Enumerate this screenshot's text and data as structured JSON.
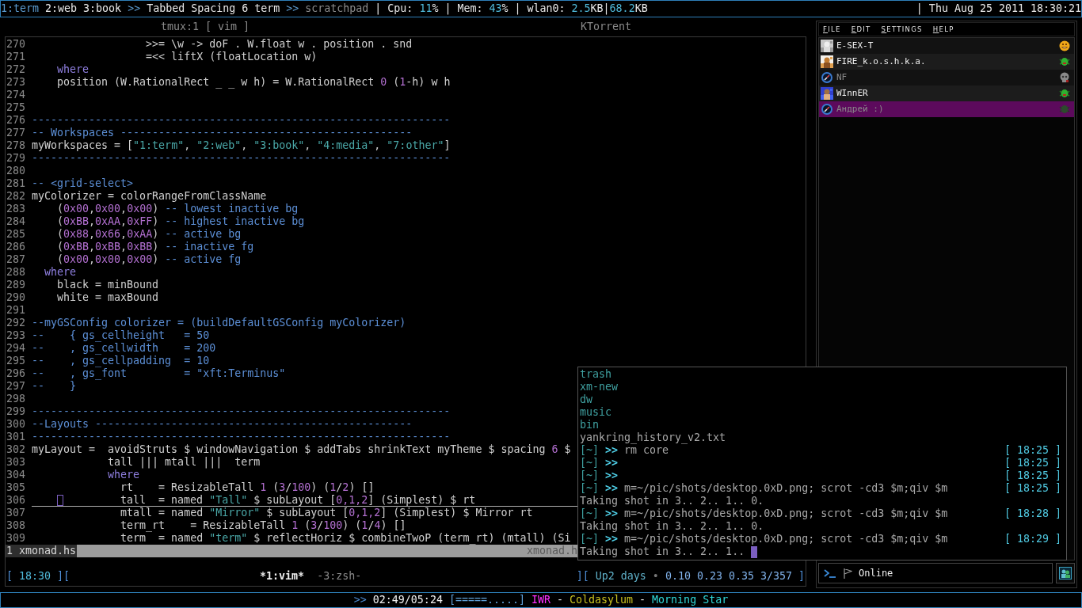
{
  "top_bar": {
    "workspaces": [
      {
        "label": "1:term",
        "selected": true
      },
      {
        "label": "2:web",
        "selected": false
      },
      {
        "label": "3:book",
        "selected": false
      }
    ],
    "layout_separator": ">>",
    "layout": "Tabbed Spacing 6 term",
    "hidden_separator": ">>",
    "hidden_workspace": "scratchpad",
    "stats": [
      {
        "text": "| Cpu: ",
        "kind": "label"
      },
      {
        "text": "11",
        "kind": "value"
      },
      {
        "text": "% | Mem: ",
        "kind": "label"
      },
      {
        "text": "43",
        "kind": "value"
      },
      {
        "text": "% | wlan0: ",
        "kind": "label"
      },
      {
        "text": "2.5",
        "kind": "value"
      },
      {
        "text": "KB|",
        "kind": "label"
      },
      {
        "text": "68.2",
        "kind": "value"
      },
      {
        "text": "KB",
        "kind": "label"
      }
    ],
    "clock": "| Thu Aug 25 2011 18:30:21"
  },
  "window_tabs": [
    {
      "label": "tmux:1 [ vim ]"
    },
    {
      "label": "KTorrent"
    }
  ],
  "editor": {
    "lines": [
      {
        "number": "270",
        "cursor_line": false,
        "segments": [
          {
            "text": "                  >>= \\w -> doF . W.float w . position . snd",
            "kind": "code"
          }
        ]
      },
      {
        "number": "271",
        "cursor_line": false,
        "segments": [
          {
            "text": "                  =<< liftX (floatLocation w)",
            "kind": "code"
          }
        ]
      },
      {
        "number": "272",
        "cursor_line": false,
        "segments": [
          {
            "text": "    where",
            "kind": "keyword"
          }
        ]
      },
      {
        "number": "273",
        "cursor_line": false,
        "segments": [
          {
            "text": "    position (W.RationalRect _ _ w h) = W.RationalRect ",
            "kind": "code"
          },
          {
            "text": "0",
            "kind": "number"
          },
          {
            "text": " (",
            "kind": "code"
          },
          {
            "text": "1",
            "kind": "number"
          },
          {
            "text": "-h) w h",
            "kind": "code"
          }
        ]
      },
      {
        "number": "274",
        "cursor_line": false
      },
      {
        "number": "275",
        "cursor_line": false
      },
      {
        "number": "276",
        "cursor_line": false,
        "segments": [
          {
            "text": "------------------------------------------------------------------",
            "kind": "comment"
          }
        ]
      },
      {
        "number": "277",
        "cursor_line": false,
        "segments": [
          {
            "text": "-- Workspaces ----------------------------------------------",
            "kind": "comment"
          }
        ]
      },
      {
        "number": "278",
        "cursor_line": false,
        "segments": [
          {
            "text": "myWorkspaces = [",
            "kind": "code"
          },
          {
            "text": "\"1:term\"",
            "kind": "string"
          },
          {
            "text": ", ",
            "kind": "code"
          },
          {
            "text": "\"2:web\"",
            "kind": "string"
          },
          {
            "text": ", ",
            "kind": "code"
          },
          {
            "text": "\"3:book\"",
            "kind": "string"
          },
          {
            "text": ", ",
            "kind": "code"
          },
          {
            "text": "\"4:media\"",
            "kind": "string"
          },
          {
            "text": ", ",
            "kind": "code"
          },
          {
            "text": "\"7:other\"",
            "kind": "string"
          },
          {
            "text": "]",
            "kind": "code"
          }
        ]
      },
      {
        "number": "279",
        "cursor_line": false,
        "segments": [
          {
            "text": "------------------------------------------------------------------",
            "kind": "comment"
          }
        ]
      },
      {
        "number": "280",
        "cursor_line": false
      },
      {
        "number": "281",
        "cursor_line": false,
        "segments": [
          {
            "text": "-- <grid-select>",
            "kind": "comment"
          }
        ]
      },
      {
        "number": "282",
        "cursor_line": false,
        "segments": [
          {
            "text": "myColorizer = colorRangeFromClassName",
            "kind": "code"
          }
        ]
      },
      {
        "number": "283",
        "cursor_line": false,
        "segments": [
          {
            "text": "    (",
            "kind": "code"
          },
          {
            "text": "0x00",
            "kind": "number"
          },
          {
            "text": ",",
            "kind": "code"
          },
          {
            "text": "0x00",
            "kind": "number"
          },
          {
            "text": ",",
            "kind": "code"
          },
          {
            "text": "0x00",
            "kind": "number"
          },
          {
            "text": ") ",
            "kind": "code"
          },
          {
            "text": "-- lowest inactive bg",
            "kind": "comment"
          }
        ]
      },
      {
        "number": "284",
        "cursor_line": false,
        "segments": [
          {
            "text": "    (",
            "kind": "code"
          },
          {
            "text": "0xBB",
            "kind": "number"
          },
          {
            "text": ",",
            "kind": "code"
          },
          {
            "text": "0xAA",
            "kind": "number"
          },
          {
            "text": ",",
            "kind": "code"
          },
          {
            "text": "0xFF",
            "kind": "number"
          },
          {
            "text": ") ",
            "kind": "code"
          },
          {
            "text": "-- highest inactive bg",
            "kind": "comment"
          }
        ]
      },
      {
        "number": "285",
        "cursor_line": false,
        "segments": [
          {
            "text": "    (",
            "kind": "code"
          },
          {
            "text": "0x88",
            "kind": "number"
          },
          {
            "text": ",",
            "kind": "code"
          },
          {
            "text": "0x66",
            "kind": "number"
          },
          {
            "text": ",",
            "kind": "code"
          },
          {
            "text": "0xAA",
            "kind": "number"
          },
          {
            "text": ") ",
            "kind": "code"
          },
          {
            "text": "-- active bg",
            "kind": "comment"
          }
        ]
      },
      {
        "number": "286",
        "cursor_line": false,
        "segments": [
          {
            "text": "    (",
            "kind": "code"
          },
          {
            "text": "0xBB",
            "kind": "number"
          },
          {
            "text": ",",
            "kind": "code"
          },
          {
            "text": "0xBB",
            "kind": "number"
          },
          {
            "text": ",",
            "kind": "code"
          },
          {
            "text": "0xBB",
            "kind": "number"
          },
          {
            "text": ") ",
            "kind": "code"
          },
          {
            "text": "-- inactive fg",
            "kind": "comment"
          }
        ]
      },
      {
        "number": "287",
        "cursor_line": false,
        "segments": [
          {
            "text": "    (",
            "kind": "code"
          },
          {
            "text": "0x00",
            "kind": "number"
          },
          {
            "text": ",",
            "kind": "code"
          },
          {
            "text": "0x00",
            "kind": "number"
          },
          {
            "text": ",",
            "kind": "code"
          },
          {
            "text": "0x00",
            "kind": "number"
          },
          {
            "text": ") ",
            "kind": "code"
          },
          {
            "text": "-- active fg",
            "kind": "comment"
          }
        ]
      },
      {
        "number": "288",
        "cursor_line": false,
        "segments": [
          {
            "text": "  where",
            "kind": "keyword"
          }
        ]
      },
      {
        "number": "289",
        "cursor_line": false,
        "segments": [
          {
            "text": "    black = minBound",
            "kind": "code"
          }
        ]
      },
      {
        "number": "290",
        "cursor_line": false,
        "segments": [
          {
            "text": "    white = maxBound",
            "kind": "code"
          }
        ]
      },
      {
        "number": "291",
        "cursor_line": false
      },
      {
        "number": "292",
        "cursor_line": false,
        "segments": [
          {
            "text": "--myGSConfig colorizer = (buildDefaultGSConfig myColorizer)",
            "kind": "comment"
          }
        ]
      },
      {
        "number": "293",
        "cursor_line": false,
        "segments": [
          {
            "text": "--    { gs_cellheight   = 50",
            "kind": "comment"
          }
        ]
      },
      {
        "number": "294",
        "cursor_line": false,
        "segments": [
          {
            "text": "--    , gs_cellwidth    = 200",
            "kind": "comment"
          }
        ]
      },
      {
        "number": "295",
        "cursor_line": false,
        "segments": [
          {
            "text": "--    , gs_cellpadding  = 10",
            "kind": "comment"
          }
        ]
      },
      {
        "number": "296",
        "cursor_line": false,
        "segments": [
          {
            "text": "--    , gs_font         = \"xft:Terminus\"",
            "kind": "comment"
          }
        ]
      },
      {
        "number": "297",
        "cursor_line": false,
        "segments": [
          {
            "text": "--    }",
            "kind": "comment"
          }
        ]
      },
      {
        "number": "298",
        "cursor_line": false
      },
      {
        "number": "299",
        "cursor_line": false,
        "segments": [
          {
            "text": "------------------------------------------------------------------",
            "kind": "comment"
          }
        ]
      },
      {
        "number": "300",
        "cursor_line": false,
        "segments": [
          {
            "text": "--Layouts --------------------------------------------------",
            "kind": "comment"
          }
        ]
      },
      {
        "number": "301",
        "cursor_line": false,
        "segments": [
          {
            "text": "------------------------------------------------------------------",
            "kind": "comment"
          }
        ]
      },
      {
        "number": "302",
        "cursor_line": false,
        "segments": [
          {
            "text": "myLayout =  avoidStruts $ windowNavigation $ addTabs shrinkText myTheme $ spacing ",
            "kind": "code"
          },
          {
            "text": "6",
            "kind": "number"
          },
          {
            "text": " $",
            "kind": "code"
          }
        ]
      },
      {
        "number": "303",
        "cursor_line": false,
        "segments": [
          {
            "text": "            tall ||| mtall |||  term",
            "kind": "code"
          }
        ]
      },
      {
        "number": "304",
        "cursor_line": false,
        "segments": [
          {
            "text": "            where",
            "kind": "keyword"
          }
        ]
      },
      {
        "number": "305",
        "cursor_line": false,
        "segments": [
          {
            "text": "              rt    = ResizableTall ",
            "kind": "code"
          },
          {
            "text": "1",
            "kind": "number"
          },
          {
            "text": " (",
            "kind": "code"
          },
          {
            "text": "3",
            "kind": "number"
          },
          {
            "text": "/",
            "kind": "code"
          },
          {
            "text": "100",
            "kind": "number"
          },
          {
            "text": ") (",
            "kind": "code"
          },
          {
            "text": "1",
            "kind": "number"
          },
          {
            "text": "/",
            "kind": "code"
          },
          {
            "text": "2",
            "kind": "number"
          },
          {
            "text": ") []",
            "kind": "code"
          }
        ]
      },
      {
        "number": "306",
        "cursor_line": true,
        "segments": [
          {
            "text": "         tall  = named ",
            "kind": "code"
          },
          {
            "text": "\"Tall\"",
            "kind": "string"
          },
          {
            "text": " $ subLayout [",
            "kind": "code"
          },
          {
            "text": "0,1,2",
            "kind": "number"
          },
          {
            "text": "] (Simplest) $ rt",
            "kind": "code"
          }
        ]
      },
      {
        "number": "307",
        "cursor_line": false,
        "segments": [
          {
            "text": "              mtall = named ",
            "kind": "code"
          },
          {
            "text": "\"Mirror\"",
            "kind": "string"
          },
          {
            "text": " $ subLayout [",
            "kind": "code"
          },
          {
            "text": "0,1,2",
            "kind": "number"
          },
          {
            "text": "] (Simplest) $ Mirror rt",
            "kind": "code"
          }
        ]
      },
      {
        "number": "308",
        "cursor_line": false,
        "segments": [
          {
            "text": "              term_rt    = ResizableTall ",
            "kind": "code"
          },
          {
            "text": "1",
            "kind": "number"
          },
          {
            "text": " (",
            "kind": "code"
          },
          {
            "text": "3",
            "kind": "number"
          },
          {
            "text": "/",
            "kind": "code"
          },
          {
            "text": "100",
            "kind": "number"
          },
          {
            "text": ") (",
            "kind": "code"
          },
          {
            "text": "1",
            "kind": "number"
          },
          {
            "text": "/",
            "kind": "code"
          },
          {
            "text": "4",
            "kind": "number"
          },
          {
            "text": ") []",
            "kind": "code"
          }
        ]
      },
      {
        "number": "309",
        "cursor_line": false,
        "segments": [
          {
            "text": "              term  = named ",
            "kind": "code"
          },
          {
            "text": "\"term\"",
            "kind": "string"
          },
          {
            "text": " $ reflectHoriz $ combineTwoP (term_rt) (mtall) (Si",
            "kind": "code"
          }
        ]
      }
    ],
    "status_line": {
      "buffer": "1 xmonad.hs",
      "file": "xmonad.h"
    }
  },
  "tmux_status": {
    "clock": [
      {
        "text": "[ ",
        "kind": "bracket"
      },
      {
        "text": "18:30",
        "kind": "value"
      },
      {
        "text": " ][",
        "kind": "bracket"
      }
    ],
    "windows": [
      {
        "label": "*1:vim*",
        "selected": true
      },
      {
        "label": "-3:zsh-",
        "selected": false
      }
    ],
    "info": [
      {
        "text": "][ ",
        "kind": "bracket"
      },
      {
        "text": "Up2 days",
        "kind": "uptime"
      },
      {
        "text": " • ",
        "kind": "dim"
      },
      {
        "text": "0.10 0.23 0.35 3/357",
        "kind": "load"
      },
      {
        "text": " ]",
        "kind": "bracket"
      }
    ]
  },
  "terminal": {
    "lines": [
      {
        "kind": "dir",
        "text": "trash"
      },
      {
        "kind": "dir",
        "text": "xm-new"
      },
      {
        "kind": "dir",
        "text": "dw"
      },
      {
        "kind": "dir",
        "text": "music"
      },
      {
        "kind": "dir",
        "text": "bin"
      },
      {
        "kind": "file",
        "text": "yankring_history_v2.txt"
      },
      {
        "kind": "prompt",
        "prompt": "[~]",
        "arrow": ">>",
        "command": "rm core",
        "time": "[ 18:25 ]"
      },
      {
        "kind": "prompt",
        "prompt": "[~]",
        "arrow": ">>",
        "time": "[ 18:25 ]"
      },
      {
        "kind": "prompt",
        "prompt": "[~]",
        "arrow": ">>",
        "time": "[ 18:25 ]"
      },
      {
        "kind": "prompt",
        "prompt": "[~]",
        "arrow": ">>",
        "command": "m=~/pic/shots/desktop.0xD.png; scrot -cd3 $m;qiv $m",
        "time": "[ 18:25 ]"
      },
      {
        "kind": "output",
        "text": "Taking shot in 3.. 2.. 1.. 0.",
        "cursor": false
      },
      {
        "kind": "prompt",
        "prompt": "[~]",
        "arrow": ">>",
        "command": "m=~/pic/shots/desktop.0xD.png; scrot -cd3 $m;qiv $m",
        "time": "[ 18:28 ]"
      },
      {
        "kind": "output",
        "text": "Taking shot in 3.. 2.. 1.. 0.",
        "cursor": false
      },
      {
        "kind": "prompt",
        "prompt": "[~]",
        "arrow": ">>",
        "command": "m=~/pic/shots/desktop.0xD.png; scrot -cd3 $m;qiv $m",
        "time": "[ 18:29 ]"
      },
      {
        "kind": "output",
        "text": "Taking shot in 3.. 2.. 1..",
        "cursor": true
      }
    ]
  },
  "contact_list": {
    "menu": [
      "FILE",
      "EDIT",
      "SETTINGS",
      "HELP"
    ],
    "contacts": [
      {
        "name": "E-SEX-T",
        "status_icon": {
          "kind": "away"
        },
        "selected": false
      },
      {
        "name": "FIRE_k.o.s.h.k.a.",
        "status_icon": {
          "kind": "online"
        },
        "selected": false
      },
      {
        "name": "NF",
        "avatar": {
          "kind": "none"
        },
        "status_icon": {
          "kind": "offline"
        },
        "selected": false
      },
      {
        "name": "WInnER",
        "status_icon": {
          "kind": "online"
        },
        "selected": false
      },
      {
        "name": "Андрей :)",
        "avatar": {
          "kind": "none"
        },
        "status_icon": {
          "kind": "idle"
        },
        "selected": true
      }
    ],
    "status_field": {
      "text": "Online"
    }
  },
  "now_playing": [
    {
      "text": ">>",
      "kind": "arrow"
    },
    {
      "text": "02:49/05:24",
      "kind": "time"
    },
    {
      "text": "[=====.....]",
      "kind": "progress"
    },
    {
      "text": "IWR",
      "kind": "label"
    },
    {
      "text": "-",
      "kind": "dash"
    },
    {
      "text": "Coldasylum",
      "kind": "artist"
    },
    {
      "text": "-",
      "kind": "dash"
    },
    {
      "text": "Morning Star",
      "kind": "title"
    }
  ]
}
